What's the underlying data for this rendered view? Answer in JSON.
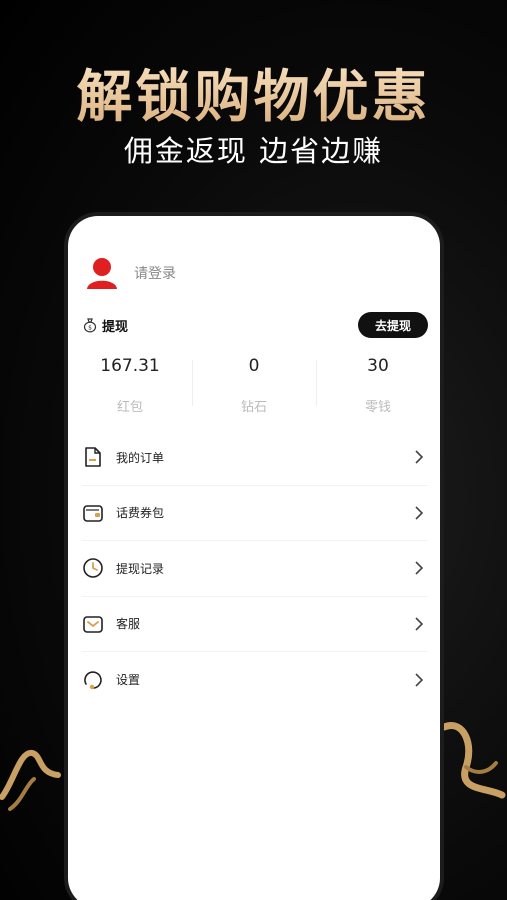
{
  "hero": {
    "title": "解锁购物优惠",
    "subtitle": "佣金返现 边省边赚"
  },
  "profile": {
    "login_text": "请登录"
  },
  "withdraw": {
    "label": "提现",
    "button_label": "去提现"
  },
  "stats": [
    {
      "value": "167.31",
      "label": "红包"
    },
    {
      "value": "0",
      "label": "钻石"
    },
    {
      "value": "30",
      "label": "零钱"
    }
  ],
  "menu": [
    {
      "label": "我的订单",
      "icon": "order-icon"
    },
    {
      "label": "话费券包",
      "icon": "wallet-icon"
    },
    {
      "label": "提现记录",
      "icon": "clock-icon"
    },
    {
      "label": "客服",
      "icon": "message-icon"
    },
    {
      "label": "设置",
      "icon": "settings-icon"
    }
  ],
  "colors": {
    "title_gold": "#e8c89e",
    "avatar_red": "#e02020",
    "button_dark": "#111111"
  }
}
